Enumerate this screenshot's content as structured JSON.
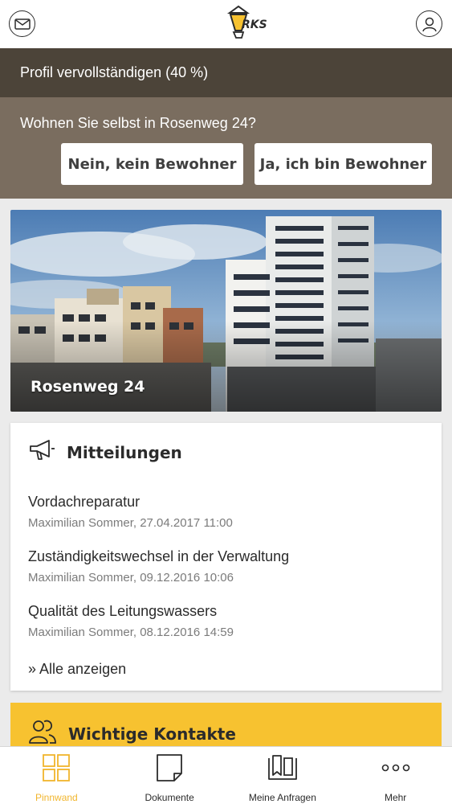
{
  "header": {
    "logo_text": "RKS"
  },
  "profile": {
    "completion_label": "Profil vervollständigen (40 %)"
  },
  "resident": {
    "question": "Wohnen Sie selbst in Rosenweg 24?",
    "no_label": "Nein, kein Bewohner",
    "yes_label": "Ja, ich bin Bewohner"
  },
  "building": {
    "name": "Rosenweg 24"
  },
  "messages": {
    "title": "Mitteilungen",
    "items": [
      {
        "title": "Vordachreparatur",
        "meta": "Maximilian Sommer, 27.04.2017 11:00"
      },
      {
        "title": "Zuständigkeitswechsel in der Verwaltung",
        "meta": "Maximilian Sommer, 09.12.2016 10:06"
      },
      {
        "title": "Qualität des Leitungswassers",
        "meta": "Maximilian Sommer, 08.12.2016 14:59"
      }
    ],
    "show_all": "» Alle anzeigen"
  },
  "contacts": {
    "title": "Wichtige Kontakte"
  },
  "nav": {
    "items": [
      {
        "label": "Pinnwand",
        "icon": "grid-icon",
        "active": true
      },
      {
        "label": "Dokumente",
        "icon": "document-icon",
        "active": false
      },
      {
        "label": "Meine Anfragen",
        "icon": "requests-icon",
        "active": false
      },
      {
        "label": "Mehr",
        "icon": "more-icon",
        "active": false
      }
    ]
  },
  "colors": {
    "accent": "#f1b52c",
    "profile_bar": "#4c4439",
    "resident_bg": "#7a6d5f",
    "contacts_bg": "#f7c230"
  }
}
